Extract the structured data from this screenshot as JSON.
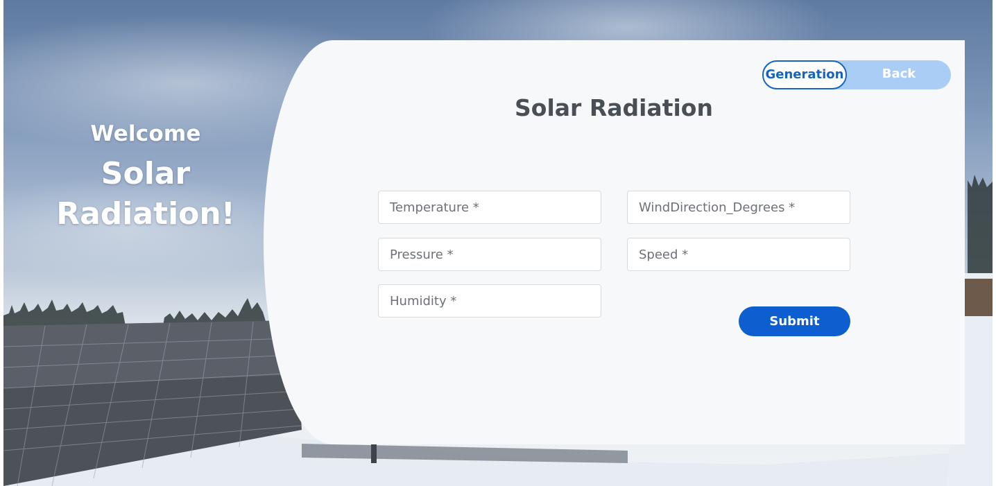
{
  "welcome": {
    "line1": "Welcome",
    "line2": "Solar",
    "line3": "Radiation!"
  },
  "toggle": {
    "active_label": "Generation",
    "other_label": "Back"
  },
  "form": {
    "title": "Solar Radiation",
    "fields": {
      "temperature": "Temperature *",
      "wind_direction": "WindDirection_Degrees *",
      "pressure": "Pressure *",
      "speed": "Speed *",
      "humidity": "Humidity *"
    },
    "submit_label": "Submit"
  },
  "colors": {
    "accent": "#0d5fcf",
    "toggle_track": "#a9cdf5",
    "card_bg": "#f6f8fa",
    "title_text": "#4a4f56"
  }
}
